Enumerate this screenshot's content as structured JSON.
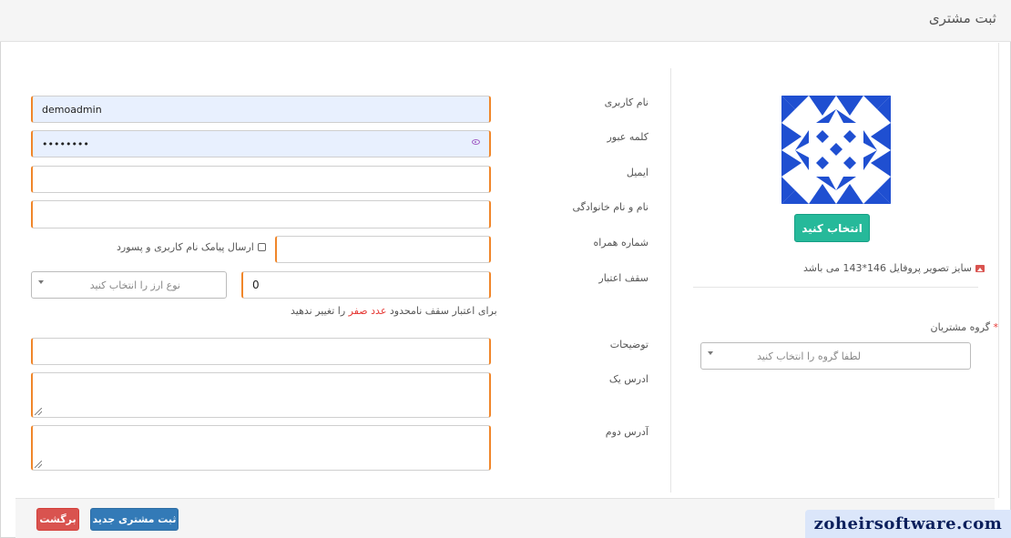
{
  "header": {
    "title": "ثبت مشتری"
  },
  "form": {
    "username": {
      "label": "نام کاربری",
      "value": "demoadmin"
    },
    "password": {
      "label": "کلمه عبور",
      "value": "••••••••"
    },
    "email": {
      "label": "ایمیل",
      "value": ""
    },
    "fullname": {
      "label": "نام و نام خانوادگی",
      "value": ""
    },
    "mobile": {
      "label": "شماره همراه",
      "value": ""
    },
    "send_sms": {
      "label": "ارسال پیامک نام کاربری و پسورد",
      "checked": false
    },
    "credit": {
      "label": "سقف اعتبار",
      "value": "0",
      "currency_placeholder": "نوع ارز را انتخاب کنید",
      "hint_before": "برای اعتبار سقف نامحدود",
      "hint_red": "عدد صفر",
      "hint_after": "را تغییر ندهید"
    },
    "notes": {
      "label": "توضیحات",
      "value": ""
    },
    "address1": {
      "label": "ادرس یک",
      "value": ""
    },
    "address2": {
      "label": "آدرس دوم",
      "value": ""
    }
  },
  "profile": {
    "choose_button": "انتخاب کنید",
    "size_note": "سایز تصویر پروفایل 146*143 می باشد",
    "image_icon": "image-icon"
  },
  "customer_group": {
    "label": "گروه مشتریان",
    "required_mark": "*",
    "placeholder": "لطفا گروه را انتخاب کنید"
  },
  "footer": {
    "submit_button": "ثبت مشتری جدید",
    "back_button": "برگشت"
  },
  "watermark": "zoheirsoftware.com",
  "colors": {
    "accent_orange": "#f0862a",
    "green": "#26b99a",
    "blue": "#337ab7",
    "red": "#d9534f",
    "avatar_blue": "#1f4fd1"
  }
}
